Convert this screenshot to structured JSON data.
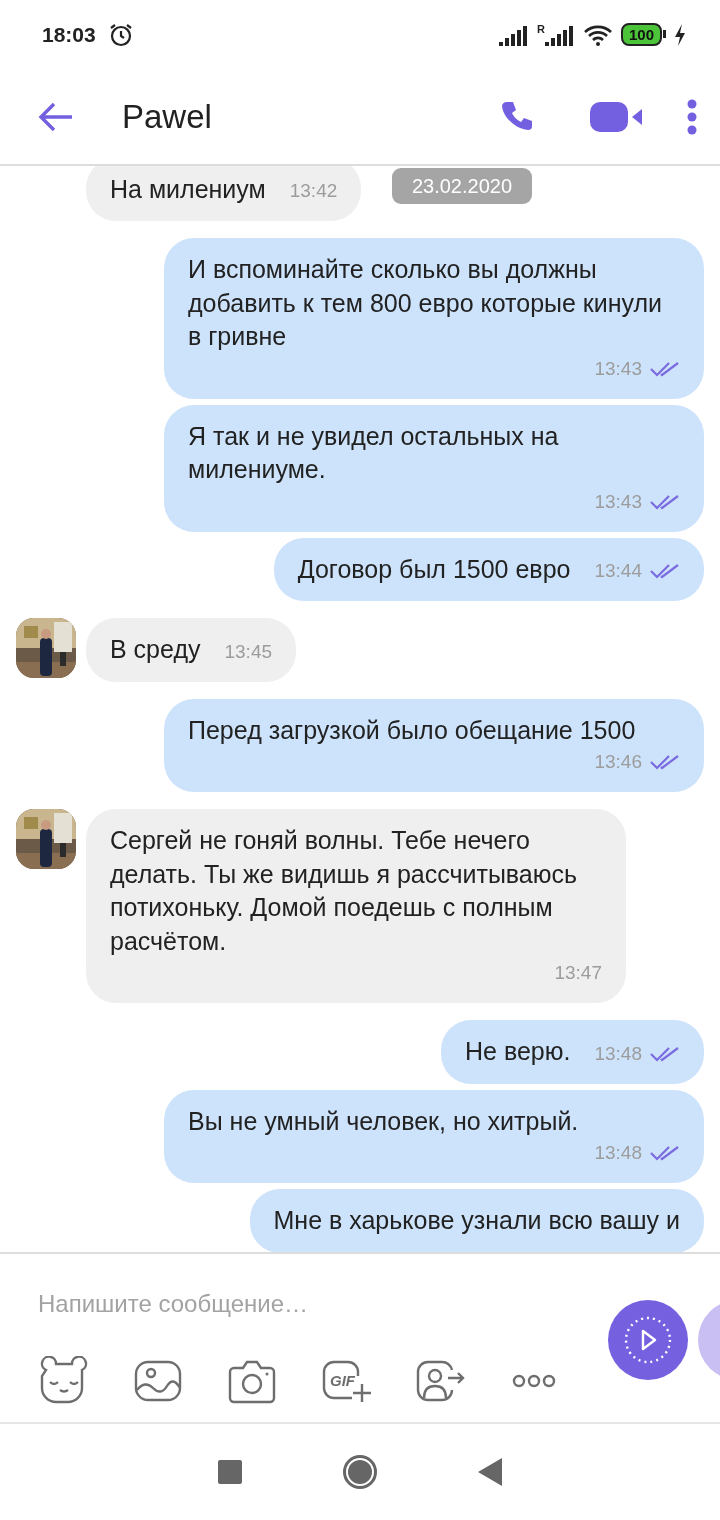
{
  "status_bar": {
    "time": "18:03",
    "roaming_mark": "R",
    "battery": "100"
  },
  "header": {
    "title": "Pawel"
  },
  "date_pill": "23.02.2020",
  "messages": [
    {
      "kind": "in",
      "text": "На милениум",
      "time": "13:42",
      "avatar": false
    },
    {
      "kind": "out",
      "text": "И вспоминайте сколько вы должны добавить к тем 800 евро которые кинули в гривне",
      "time": "13:43",
      "read": true
    },
    {
      "kind": "out",
      "text": "Я так и не увидел остальных на милениуме.",
      "time": "13:43",
      "read": true
    },
    {
      "kind": "out",
      "text": "Договор был 1500 евро",
      "time": "13:44",
      "read": true
    },
    {
      "kind": "in",
      "text": "В среду",
      "time": "13:45",
      "avatar": true
    },
    {
      "kind": "out",
      "text": "Перед загрузкой было обещание 1500",
      "time": "13:46",
      "read": true
    },
    {
      "kind": "in",
      "text": "Сергей не гоняй волны. Тебе нечего делать. Ты же видишь я рассчитываюсь потихоньку. Домой поедешь с полным расчётом.",
      "time": "13:47",
      "avatar": true
    },
    {
      "kind": "out",
      "text": "Не верю.",
      "time": "13:48",
      "read": true
    },
    {
      "kind": "out",
      "text": "Вы не умный человек, но хитрый.",
      "time": "13:48",
      "read": true
    },
    {
      "kind": "out",
      "text": "Мне в харькове узнали всю вашу и"
    }
  ],
  "composer": {
    "placeholder": "Напишите сообщение…",
    "gif_label": "GIF"
  }
}
